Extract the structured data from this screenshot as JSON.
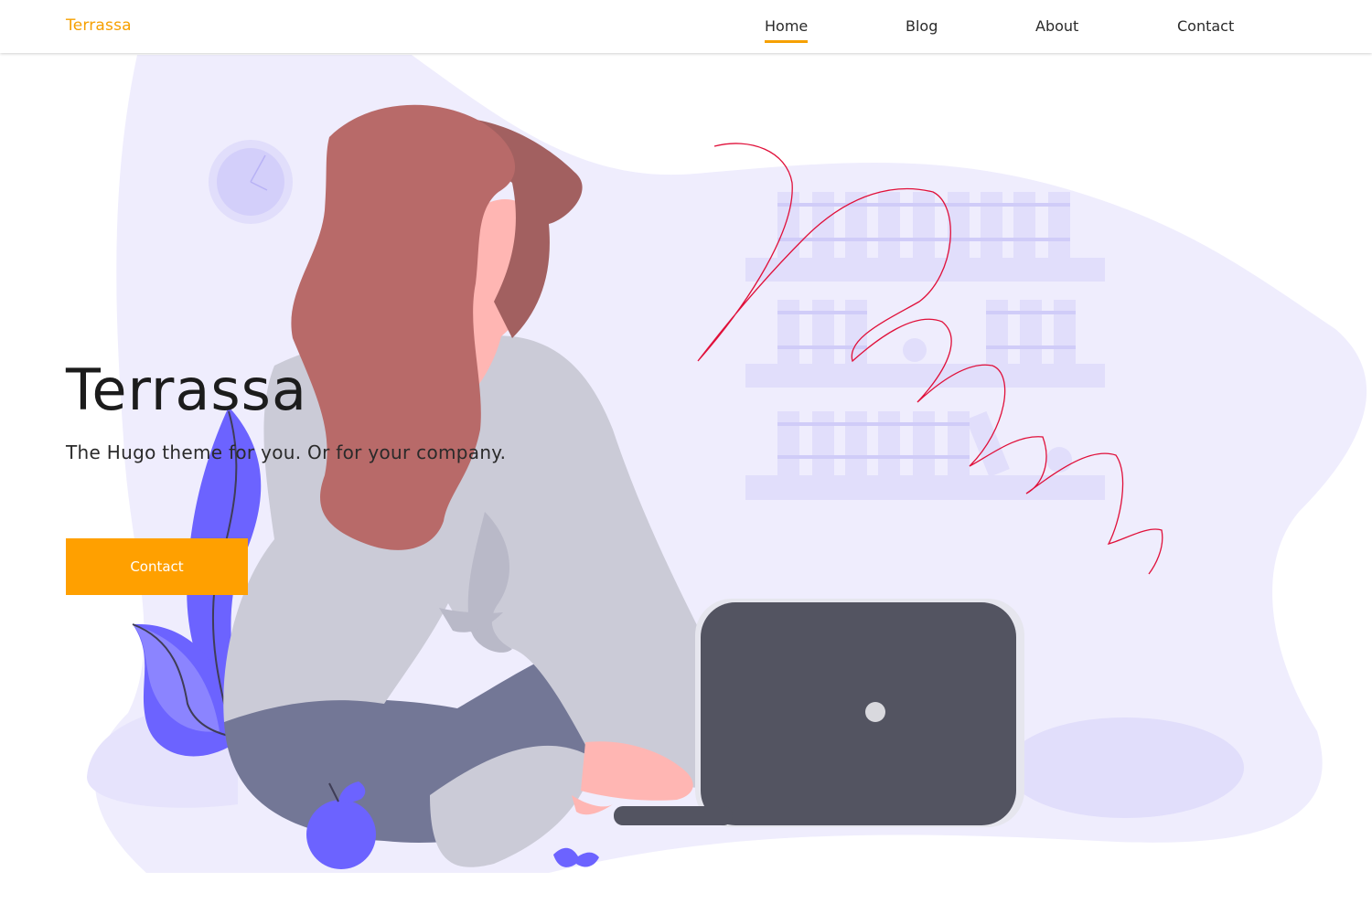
{
  "header": {
    "brand": "Terrassa",
    "nav": [
      {
        "label": "Home",
        "active": true
      },
      {
        "label": "Blog",
        "active": false
      },
      {
        "label": "About",
        "active": false
      },
      {
        "label": "Contact",
        "active": false
      }
    ]
  },
  "hero": {
    "title": "Terrassa",
    "subtitle": "The Hugo theme for you. Or for your company.",
    "cta_label": "Contact"
  },
  "colors": {
    "accent": "#ffa000",
    "blob": "#efedfd",
    "shelf": "#e1defb",
    "hair": "#b86a69",
    "skin": "#ffb6b3",
    "shirt": "#cbcbd7",
    "pants": "#737796",
    "laptop": "#535461",
    "plant": "#6c63ff",
    "annotation": "#e0103a"
  }
}
